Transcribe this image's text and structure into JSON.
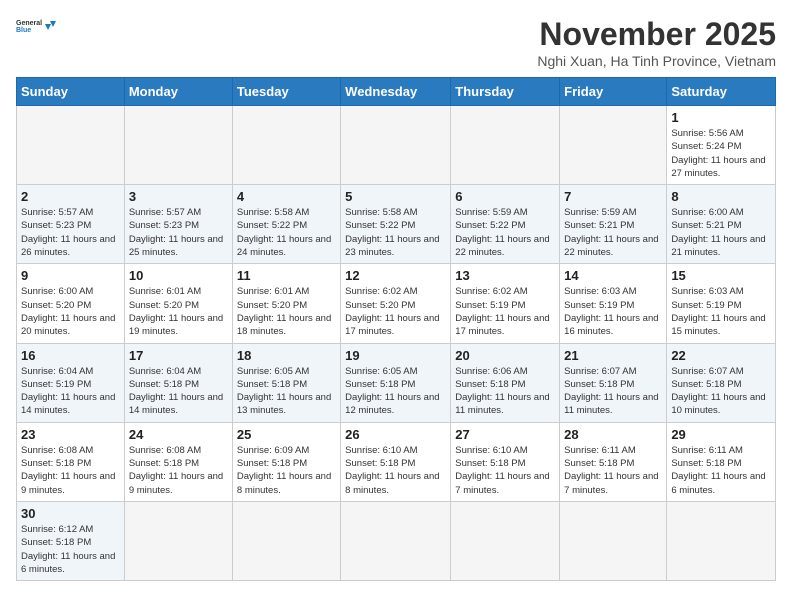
{
  "header": {
    "logo_general": "General",
    "logo_blue": "Blue",
    "month_title": "November 2025",
    "subtitle": "Nghi Xuan, Ha Tinh Province, Vietnam"
  },
  "days_of_week": [
    "Sunday",
    "Monday",
    "Tuesday",
    "Wednesday",
    "Thursday",
    "Friday",
    "Saturday"
  ],
  "days": {
    "d1": {
      "num": "1",
      "sunrise": "Sunrise: 5:56 AM",
      "sunset": "Sunset: 5:24 PM",
      "daylight": "Daylight: 11 hours and 27 minutes."
    },
    "d2": {
      "num": "2",
      "sunrise": "Sunrise: 5:57 AM",
      "sunset": "Sunset: 5:23 PM",
      "daylight": "Daylight: 11 hours and 26 minutes."
    },
    "d3": {
      "num": "3",
      "sunrise": "Sunrise: 5:57 AM",
      "sunset": "Sunset: 5:23 PM",
      "daylight": "Daylight: 11 hours and 25 minutes."
    },
    "d4": {
      "num": "4",
      "sunrise": "Sunrise: 5:58 AM",
      "sunset": "Sunset: 5:22 PM",
      "daylight": "Daylight: 11 hours and 24 minutes."
    },
    "d5": {
      "num": "5",
      "sunrise": "Sunrise: 5:58 AM",
      "sunset": "Sunset: 5:22 PM",
      "daylight": "Daylight: 11 hours and 23 minutes."
    },
    "d6": {
      "num": "6",
      "sunrise": "Sunrise: 5:59 AM",
      "sunset": "Sunset: 5:22 PM",
      "daylight": "Daylight: 11 hours and 22 minutes."
    },
    "d7": {
      "num": "7",
      "sunrise": "Sunrise: 5:59 AM",
      "sunset": "Sunset: 5:21 PM",
      "daylight": "Daylight: 11 hours and 22 minutes."
    },
    "d8": {
      "num": "8",
      "sunrise": "Sunrise: 6:00 AM",
      "sunset": "Sunset: 5:21 PM",
      "daylight": "Daylight: 11 hours and 21 minutes."
    },
    "d9": {
      "num": "9",
      "sunrise": "Sunrise: 6:00 AM",
      "sunset": "Sunset: 5:20 PM",
      "daylight": "Daylight: 11 hours and 20 minutes."
    },
    "d10": {
      "num": "10",
      "sunrise": "Sunrise: 6:01 AM",
      "sunset": "Sunset: 5:20 PM",
      "daylight": "Daylight: 11 hours and 19 minutes."
    },
    "d11": {
      "num": "11",
      "sunrise": "Sunrise: 6:01 AM",
      "sunset": "Sunset: 5:20 PM",
      "daylight": "Daylight: 11 hours and 18 minutes."
    },
    "d12": {
      "num": "12",
      "sunrise": "Sunrise: 6:02 AM",
      "sunset": "Sunset: 5:20 PM",
      "daylight": "Daylight: 11 hours and 17 minutes."
    },
    "d13": {
      "num": "13",
      "sunrise": "Sunrise: 6:02 AM",
      "sunset": "Sunset: 5:19 PM",
      "daylight": "Daylight: 11 hours and 17 minutes."
    },
    "d14": {
      "num": "14",
      "sunrise": "Sunrise: 6:03 AM",
      "sunset": "Sunset: 5:19 PM",
      "daylight": "Daylight: 11 hours and 16 minutes."
    },
    "d15": {
      "num": "15",
      "sunrise": "Sunrise: 6:03 AM",
      "sunset": "Sunset: 5:19 PM",
      "daylight": "Daylight: 11 hours and 15 minutes."
    },
    "d16": {
      "num": "16",
      "sunrise": "Sunrise: 6:04 AM",
      "sunset": "Sunset: 5:19 PM",
      "daylight": "Daylight: 11 hours and 14 minutes."
    },
    "d17": {
      "num": "17",
      "sunrise": "Sunrise: 6:04 AM",
      "sunset": "Sunset: 5:18 PM",
      "daylight": "Daylight: 11 hours and 14 minutes."
    },
    "d18": {
      "num": "18",
      "sunrise": "Sunrise: 6:05 AM",
      "sunset": "Sunset: 5:18 PM",
      "daylight": "Daylight: 11 hours and 13 minutes."
    },
    "d19": {
      "num": "19",
      "sunrise": "Sunrise: 6:05 AM",
      "sunset": "Sunset: 5:18 PM",
      "daylight": "Daylight: 11 hours and 12 minutes."
    },
    "d20": {
      "num": "20",
      "sunrise": "Sunrise: 6:06 AM",
      "sunset": "Sunset: 5:18 PM",
      "daylight": "Daylight: 11 hours and 11 minutes."
    },
    "d21": {
      "num": "21",
      "sunrise": "Sunrise: 6:07 AM",
      "sunset": "Sunset: 5:18 PM",
      "daylight": "Daylight: 11 hours and 11 minutes."
    },
    "d22": {
      "num": "22",
      "sunrise": "Sunrise: 6:07 AM",
      "sunset": "Sunset: 5:18 PM",
      "daylight": "Daylight: 11 hours and 10 minutes."
    },
    "d23": {
      "num": "23",
      "sunrise": "Sunrise: 6:08 AM",
      "sunset": "Sunset: 5:18 PM",
      "daylight": "Daylight: 11 hours and 9 minutes."
    },
    "d24": {
      "num": "24",
      "sunrise": "Sunrise: 6:08 AM",
      "sunset": "Sunset: 5:18 PM",
      "daylight": "Daylight: 11 hours and 9 minutes."
    },
    "d25": {
      "num": "25",
      "sunrise": "Sunrise: 6:09 AM",
      "sunset": "Sunset: 5:18 PM",
      "daylight": "Daylight: 11 hours and 8 minutes."
    },
    "d26": {
      "num": "26",
      "sunrise": "Sunrise: 6:10 AM",
      "sunset": "Sunset: 5:18 PM",
      "daylight": "Daylight: 11 hours and 8 minutes."
    },
    "d27": {
      "num": "27",
      "sunrise": "Sunrise: 6:10 AM",
      "sunset": "Sunset: 5:18 PM",
      "daylight": "Daylight: 11 hours and 7 minutes."
    },
    "d28": {
      "num": "28",
      "sunrise": "Sunrise: 6:11 AM",
      "sunset": "Sunset: 5:18 PM",
      "daylight": "Daylight: 11 hours and 7 minutes."
    },
    "d29": {
      "num": "29",
      "sunrise": "Sunrise: 6:11 AM",
      "sunset": "Sunset: 5:18 PM",
      "daylight": "Daylight: 11 hours and 6 minutes."
    },
    "d30": {
      "num": "30",
      "sunrise": "Sunrise: 6:12 AM",
      "sunset": "Sunset: 5:18 PM",
      "daylight": "Daylight: 11 hours and 6 minutes."
    }
  }
}
